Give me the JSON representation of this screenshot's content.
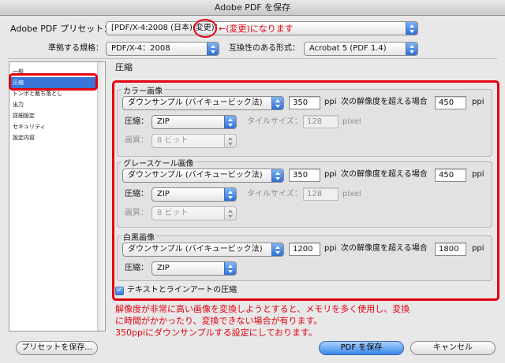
{
  "window": {
    "title": "Adobe PDF を保存"
  },
  "preset": {
    "label": "Adobe PDF プリセット：",
    "value": "[PDF/X-4:2008 (日本)(変更)]"
  },
  "standard": {
    "label": "準拠する規格：",
    "value": "PDF/X-4：2008"
  },
  "compat": {
    "label": "互換性のある形式：",
    "value": "Acrobat 5 (PDF 1.4)"
  },
  "annotation_top": "←(変更)になります",
  "sidebar": {
    "items": [
      {
        "label": "一般"
      },
      {
        "label": "圧縮"
      },
      {
        "label": "トンボと裁ち落とし"
      },
      {
        "label": "出力"
      },
      {
        "label": "詳細設定"
      },
      {
        "label": "セキュリティ"
      },
      {
        "label": "設定内容"
      }
    ]
  },
  "main": {
    "heading": "圧縮",
    "color": {
      "title": "カラー画像",
      "sampling": "ダウンサンプル (バイキュービック法)",
      "ppi": "350",
      "ppi_unit": "ppi",
      "above_label": "次の解像度を超える場合",
      "above_value": "450",
      "above_unit": "ppi",
      "compression_label": "圧縮：",
      "compression": "ZIP",
      "tile_label": "タイルサイズ：",
      "tile_value": "128",
      "tile_unit": "pixel",
      "quality_label": "画質：",
      "quality": "8 ビット"
    },
    "gray": {
      "title": "グレースケール画像",
      "sampling": "ダウンサンプル (バイキュービック法)",
      "ppi": "350",
      "ppi_unit": "ppi",
      "above_label": "次の解像度を超える場合",
      "above_value": "450",
      "above_unit": "ppi",
      "compression_label": "圧縮：",
      "compression": "ZIP",
      "tile_label": "タイルサイズ：",
      "tile_value": "128",
      "tile_unit": "pixel",
      "quality_label": "画質：",
      "quality": "8 ビット"
    },
    "mono": {
      "title": "白黒画像",
      "sampling": "ダウンサンプル (バイキュービック法)",
      "ppi": "1200",
      "ppi_unit": "ppi",
      "above_label": "次の解像度を超える場合",
      "above_value": "1800",
      "above_unit": "ppi",
      "compression_label": "圧縮：",
      "compression": "ZIP"
    },
    "text_art_label": "テキストとラインアートの圧縮",
    "text_art_checked": true
  },
  "annotation_bottom": {
    "line1": "解像度が非常に高い画像を変換しようとすると、メモリを多く使用し、変換",
    "line2": "に時間がかかったり、変換できない場合が有ります。",
    "line3": "350ppiにダウンサンプルする設定にしております。"
  },
  "buttons": {
    "save_preset": "プリセットを保存...",
    "save_pdf": "PDF を保存",
    "cancel": "キャンセル"
  },
  "colors": {
    "accent": "#3875d7",
    "annotation": "#e3000f"
  }
}
